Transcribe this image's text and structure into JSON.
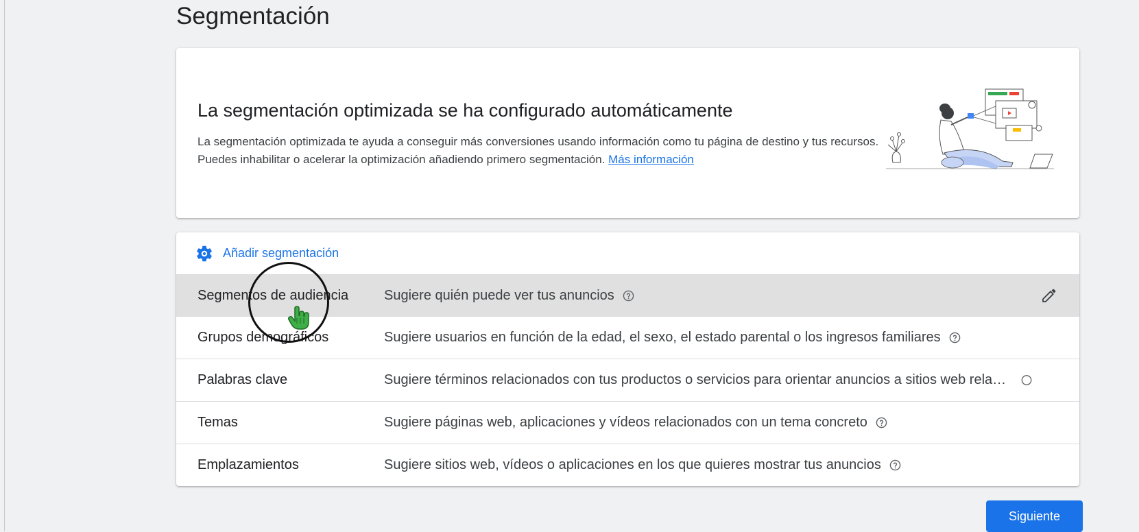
{
  "page": {
    "title": "Segmentación"
  },
  "info_card": {
    "title": "La segmentación optimizada se ha configurado automáticamente",
    "description": "La segmentación optimizada te ayuda a conseguir más conversiones usando información como tu página de destino y tus recursos. Puedes inhabilitar o acelerar la optimización añadiendo primero segmentación.",
    "link_label": "Más información",
    "illustration_icon": "person-with-screens-illustration"
  },
  "targeting": {
    "add_label": "Añadir segmentación",
    "add_icon": "gear-icon",
    "rows": [
      {
        "name": "Segmentos de audiencia",
        "description": "Sugiere quién puede ver tus anuncios"
      },
      {
        "name": "Grupos demográficos",
        "description": "Sugiere usuarios en función de la edad, el sexo, el estado parental o los ingresos familiares"
      },
      {
        "name": "Palabras clave",
        "description": "Sugiere términos relacionados con tus productos o servicios para orientar anuncios a sitios web relacionados"
      },
      {
        "name": "Temas",
        "description": "Sugiere páginas web, aplicaciones y vídeos relacionados con un tema concreto"
      },
      {
        "name": "Emplazamientos",
        "description": "Sugiere sitios web, vídeos o aplicaciones en los que quieres mostrar tus anuncios"
      }
    ]
  },
  "footer": {
    "next_label": "Siguiente"
  },
  "colors": {
    "accent": "#1a73e8",
    "background": "#f0f1f3",
    "hover_row": "#e0e0e0",
    "cursor_green": "#3fae49"
  }
}
